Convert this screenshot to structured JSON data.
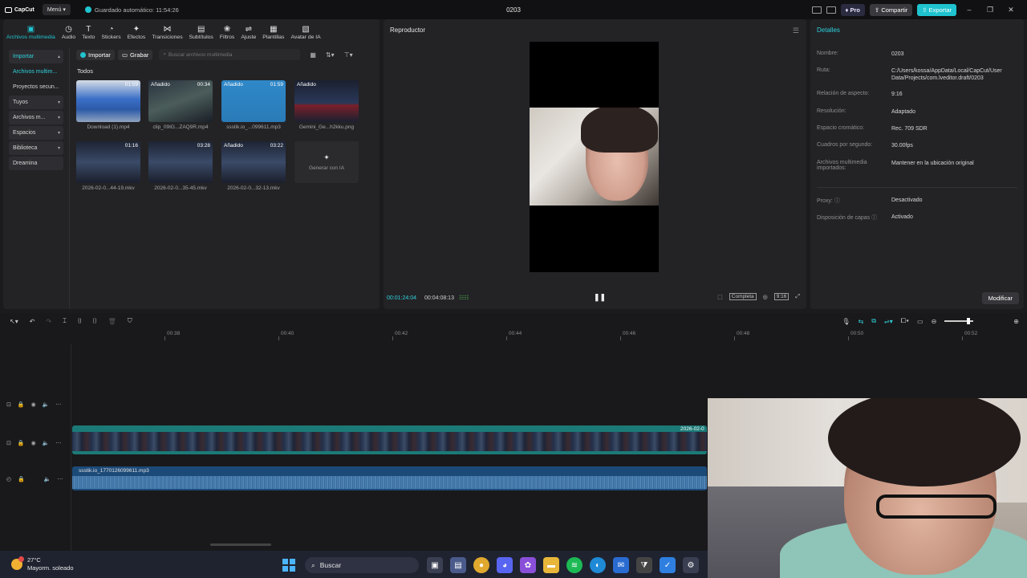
{
  "titlebar": {
    "logo": "CapCut",
    "menu": "Menú",
    "autosave": "Guardado automático: 11:54:26",
    "project": "0203",
    "pro": "Pro",
    "share": "Compartir",
    "export": "Exportar"
  },
  "toptabs": [
    {
      "label": "Archivos multimedia",
      "icon": "▣"
    },
    {
      "label": "Audio",
      "icon": "◷"
    },
    {
      "label": "Texto",
      "icon": "T"
    },
    {
      "label": "Stickers",
      "icon": "◔"
    },
    {
      "label": "Efectos",
      "icon": "✦"
    },
    {
      "label": "Transiciones",
      "icon": "⋈"
    },
    {
      "label": "Subtítulos",
      "icon": "▤"
    },
    {
      "label": "Filtros",
      "icon": "❀"
    },
    {
      "label": "Ajuste",
      "icon": "⇌"
    },
    {
      "label": "Plantillas",
      "icon": "▦"
    },
    {
      "label": "Avatar de IA",
      "icon": "▧"
    }
  ],
  "sidebar": [
    {
      "label": "Importar",
      "chev": "▴"
    },
    {
      "label": "Archivos multim..."
    },
    {
      "label": "Proyectos secun..."
    },
    {
      "label": "Tuyos",
      "chev": "▾"
    },
    {
      "label": "Archivos m...",
      "chev": "▾"
    },
    {
      "label": "Espacios",
      "chev": "▾"
    },
    {
      "label": "Biblioteca",
      "chev": "▾"
    },
    {
      "label": "Dreamina"
    }
  ],
  "media": {
    "import_label": "Importar",
    "record_label": "Grabar",
    "search_placeholder": "Buscar archivos multimedia",
    "section": "Todos",
    "items": [
      {
        "badge": "",
        "duration": "01:59",
        "caption": "Download (1).mp4"
      },
      {
        "badge": "Añadido",
        "duration": "00:34",
        "caption": "clip_09IG...ZAQ9R.mp4"
      },
      {
        "badge": "Añadido",
        "duration": "01:59",
        "caption": "ssstik.io_...099611.mp3"
      },
      {
        "badge": "Añadido",
        "duration": "",
        "caption": "Gemini_Ge...h2kku.png"
      },
      {
        "badge": "",
        "duration": "01:16",
        "caption": "2026-02-0...44-19.mkv"
      },
      {
        "badge": "",
        "duration": "03:28",
        "caption": "2026-02-0...35-45.mkv"
      },
      {
        "badge": "Añadido",
        "duration": "03:22",
        "caption": "2026-02-0...32-13.mkv"
      }
    ],
    "gen_ai": "Generar con IA"
  },
  "player": {
    "title": "Reproductor",
    "current_time": "00:01:24:04",
    "total_time": "00:04:08:13",
    "complete": "Completa",
    "ratio": "9:16"
  },
  "details": {
    "title": "Detalles",
    "rows": [
      {
        "label": "Nombre:",
        "value": "0203"
      },
      {
        "label": "Ruta:",
        "value": "C:/Users/kossa/AppData/Local/CapCut/User Data/Projects/com.lveditor.draft/0203"
      },
      {
        "label": "Relación de aspecto:",
        "value": "9:16"
      },
      {
        "label": "Resolución:",
        "value": "Adaptado"
      },
      {
        "label": "Espacio cromático:",
        "value": "Rec. 709 SDR"
      },
      {
        "label": "Cuadros por segundo:",
        "value": "30.00fps"
      },
      {
        "label": "Archivos multimedia importados:",
        "value": "Mantener en la ubicación original"
      },
      {
        "label": "Proxy: ⓘ",
        "value": "Desactivado"
      },
      {
        "label": "Disposición de capas ⓘ",
        "value": "Activado"
      }
    ],
    "modify": "Modificar"
  },
  "timeline": {
    "ruler": [
      "00:38",
      "00:40",
      "00:42",
      "00:44",
      "00:46",
      "00:48",
      "00:50",
      "00:52"
    ],
    "video_clip_label": "2026-02-0",
    "audio_clip_label": "ssstik.io_1770126099611.mp3"
  },
  "taskbar": {
    "temp": "27°C",
    "weather": "Mayorm. soleado",
    "search": "Buscar"
  }
}
